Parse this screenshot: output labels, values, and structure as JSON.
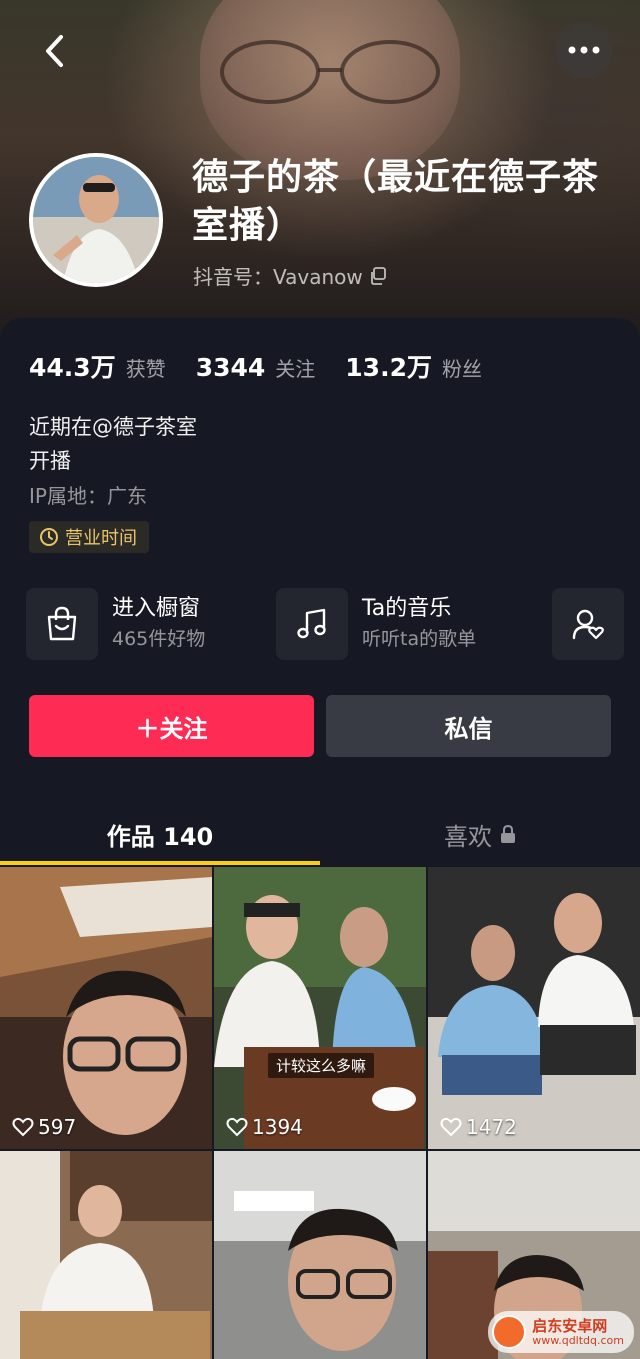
{
  "header": {
    "name": "德子的茶（最近在德子茶室播）",
    "douyin_id_label": "抖音号：Vavanow",
    "back_icon": "chevron-left-icon",
    "more_icon": "more-dots-icon"
  },
  "stats": [
    {
      "value": "44.3万",
      "label": "获赞"
    },
    {
      "value": "3344",
      "label": "关注"
    },
    {
      "value": "13.2万",
      "label": "粉丝"
    }
  ],
  "bio": {
    "line1": "近期在@德子茶室",
    "line2": "开播",
    "ip": "IP属地：广东",
    "business_tag": "营业时间"
  },
  "entries": [
    {
      "title": "进入橱窗",
      "sub": "465件好物",
      "icon": "shopping-bag-icon"
    },
    {
      "title": "Ta的音乐",
      "sub": "听听ta的歌单",
      "icon": "music-note-icon"
    },
    {
      "title": "",
      "sub": "",
      "icon": "user-heart-icon"
    }
  ],
  "actions": {
    "follow": "＋关注",
    "message": "私信"
  },
  "tabs": {
    "works": "作品 140",
    "likes": "喜欢"
  },
  "videos": [
    {
      "likes": "597",
      "caption": ""
    },
    {
      "likes": "1394",
      "caption": "计较这么多嘛"
    },
    {
      "likes": "1472",
      "caption": ""
    },
    {
      "likes": "",
      "caption": ""
    },
    {
      "likes": "",
      "caption": ""
    },
    {
      "likes": "",
      "caption": ""
    }
  ],
  "watermark": {
    "title": "启东安卓网",
    "url": "www.qdltdq.com"
  },
  "colors": {
    "background": "#161823",
    "follow_button": "#fe2c55",
    "message_button": "#393b44",
    "tab_indicator": "#face15",
    "business_tag_text": "#e8c56a"
  }
}
